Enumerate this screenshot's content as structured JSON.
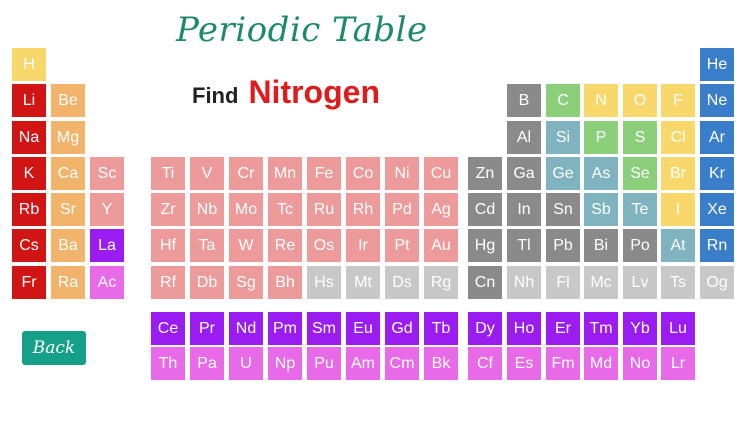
{
  "title": "Periodic Table",
  "prompt": {
    "find_label": "Find",
    "target": "Nitrogen"
  },
  "back_label": "Back",
  "colors": {
    "alkali": "#d11414",
    "alkaline": "#f2b36b",
    "hydrogen": "#f8d86b",
    "transition": "#ec9a9a",
    "unknown": "#c8c8c8",
    "post_transition": "#8e8e8e",
    "metalloid": "#7fb3bf",
    "nonmetal": "#8bcf7b",
    "halogen": "#f8d86b",
    "noble": "#3a7dc8",
    "lanthanide": "#9b1cf0",
    "actinide": "#e86ae8",
    "gray_dark": "#8a8a8a"
  },
  "rows": [
    {
      "row": 1,
      "elements": [
        {
          "symbol": "H",
          "col": 1,
          "type": "hydrogen"
        },
        {
          "symbol": "He",
          "col": 18,
          "type": "noble"
        }
      ]
    },
    {
      "row": 2,
      "elements": [
        {
          "symbol": "Li",
          "col": 1,
          "type": "alkali"
        },
        {
          "symbol": "Be",
          "col": 2,
          "type": "alkaline"
        },
        {
          "symbol": "B",
          "col": 13,
          "type": "gray_dark"
        },
        {
          "symbol": "C",
          "col": 14,
          "type": "nonmetal"
        },
        {
          "symbol": "N",
          "col": 15,
          "type": "halogen"
        },
        {
          "symbol": "O",
          "col": 16,
          "type": "halogen"
        },
        {
          "symbol": "F",
          "col": 17,
          "type": "halogen"
        },
        {
          "symbol": "Ne",
          "col": 18,
          "type": "noble"
        }
      ]
    },
    {
      "row": 3,
      "elements": [
        {
          "symbol": "Na",
          "col": 1,
          "type": "alkali"
        },
        {
          "symbol": "Mg",
          "col": 2,
          "type": "alkaline"
        },
        {
          "symbol": "Al",
          "col": 13,
          "type": "gray_dark"
        },
        {
          "symbol": "Si",
          "col": 14,
          "type": "metalloid"
        },
        {
          "symbol": "P",
          "col": 15,
          "type": "nonmetal"
        },
        {
          "symbol": "S",
          "col": 16,
          "type": "nonmetal"
        },
        {
          "symbol": "Cl",
          "col": 17,
          "type": "halogen"
        },
        {
          "symbol": "Ar",
          "col": 18,
          "type": "noble"
        }
      ]
    },
    {
      "row": 4,
      "elements": [
        {
          "symbol": "K",
          "col": 1,
          "type": "alkali"
        },
        {
          "symbol": "Ca",
          "col": 2,
          "type": "alkaline"
        },
        {
          "symbol": "Sc",
          "col": 3,
          "type": "transition"
        },
        {
          "symbol": "Ti",
          "col": 4,
          "type": "transition"
        },
        {
          "symbol": "V",
          "col": 5,
          "type": "transition"
        },
        {
          "symbol": "Cr",
          "col": 6,
          "type": "transition"
        },
        {
          "symbol": "Mn",
          "col": 7,
          "type": "transition"
        },
        {
          "symbol": "Fe",
          "col": 8,
          "type": "transition"
        },
        {
          "symbol": "Co",
          "col": 9,
          "type": "transition"
        },
        {
          "symbol": "Ni",
          "col": 10,
          "type": "transition"
        },
        {
          "symbol": "Cu",
          "col": 11,
          "type": "transition"
        },
        {
          "symbol": "Zn",
          "col": 12,
          "type": "gray_dark"
        },
        {
          "symbol": "Ga",
          "col": 13,
          "type": "gray_dark"
        },
        {
          "symbol": "Ge",
          "col": 14,
          "type": "metalloid"
        },
        {
          "symbol": "As",
          "col": 15,
          "type": "metalloid"
        },
        {
          "symbol": "Se",
          "col": 16,
          "type": "nonmetal"
        },
        {
          "symbol": "Br",
          "col": 17,
          "type": "halogen"
        },
        {
          "symbol": "Kr",
          "col": 18,
          "type": "noble"
        }
      ]
    },
    {
      "row": 5,
      "elements": [
        {
          "symbol": "Rb",
          "col": 1,
          "type": "alkali"
        },
        {
          "symbol": "Sr",
          "col": 2,
          "type": "alkaline"
        },
        {
          "symbol": "Y",
          "col": 3,
          "type": "transition"
        },
        {
          "symbol": "Zr",
          "col": 4,
          "type": "transition"
        },
        {
          "symbol": "Nb",
          "col": 5,
          "type": "transition"
        },
        {
          "symbol": "Mo",
          "col": 6,
          "type": "transition"
        },
        {
          "symbol": "Tc",
          "col": 7,
          "type": "transition"
        },
        {
          "symbol": "Ru",
          "col": 8,
          "type": "transition"
        },
        {
          "symbol": "Rh",
          "col": 9,
          "type": "transition"
        },
        {
          "symbol": "Pd",
          "col": 10,
          "type": "transition"
        },
        {
          "symbol": "Ag",
          "col": 11,
          "type": "transition"
        },
        {
          "symbol": "Cd",
          "col": 12,
          "type": "gray_dark"
        },
        {
          "symbol": "In",
          "col": 13,
          "type": "gray_dark"
        },
        {
          "symbol": "Sn",
          "col": 14,
          "type": "gray_dark"
        },
        {
          "symbol": "Sb",
          "col": 15,
          "type": "metalloid"
        },
        {
          "symbol": "Te",
          "col": 16,
          "type": "metalloid"
        },
        {
          "symbol": "I",
          "col": 17,
          "type": "halogen"
        },
        {
          "symbol": "Xe",
          "col": 18,
          "type": "noble"
        }
      ]
    },
    {
      "row": 6,
      "elements": [
        {
          "symbol": "Cs",
          "col": 1,
          "type": "alkali"
        },
        {
          "symbol": "Ba",
          "col": 2,
          "type": "alkaline"
        },
        {
          "symbol": "La",
          "col": 3,
          "type": "lanthanide"
        },
        {
          "symbol": "Hf",
          "col": 4,
          "type": "transition"
        },
        {
          "symbol": "Ta",
          "col": 5,
          "type": "transition"
        },
        {
          "symbol": "W",
          "col": 6,
          "type": "transition"
        },
        {
          "symbol": "Re",
          "col": 7,
          "type": "transition"
        },
        {
          "symbol": "Os",
          "col": 8,
          "type": "transition"
        },
        {
          "symbol": "Ir",
          "col": 9,
          "type": "transition"
        },
        {
          "symbol": "Pt",
          "col": 10,
          "type": "transition"
        },
        {
          "symbol": "Au",
          "col": 11,
          "type": "transition"
        },
        {
          "symbol": "Hg",
          "col": 12,
          "type": "gray_dark"
        },
        {
          "symbol": "Tl",
          "col": 13,
          "type": "gray_dark"
        },
        {
          "symbol": "Pb",
          "col": 14,
          "type": "gray_dark"
        },
        {
          "symbol": "Bi",
          "col": 15,
          "type": "gray_dark"
        },
        {
          "symbol": "Po",
          "col": 16,
          "type": "gray_dark"
        },
        {
          "symbol": "At",
          "col": 17,
          "type": "metalloid"
        },
        {
          "symbol": "Rn",
          "col": 18,
          "type": "noble"
        }
      ]
    },
    {
      "row": 7,
      "elements": [
        {
          "symbol": "Fr",
          "col": 1,
          "type": "alkali"
        },
        {
          "symbol": "Ra",
          "col": 2,
          "type": "alkaline"
        },
        {
          "symbol": "Ac",
          "col": 3,
          "type": "actinide"
        },
        {
          "symbol": "Rf",
          "col": 4,
          "type": "transition"
        },
        {
          "symbol": "Db",
          "col": 5,
          "type": "transition"
        },
        {
          "symbol": "Sg",
          "col": 6,
          "type": "transition"
        },
        {
          "symbol": "Bh",
          "col": 7,
          "type": "transition"
        },
        {
          "symbol": "Hs",
          "col": 8,
          "type": "unknown"
        },
        {
          "symbol": "Mt",
          "col": 9,
          "type": "unknown"
        },
        {
          "symbol": "Ds",
          "col": 10,
          "type": "unknown"
        },
        {
          "symbol": "Rg",
          "col": 11,
          "type": "unknown"
        },
        {
          "symbol": "Cn",
          "col": 12,
          "type": "gray_dark"
        },
        {
          "symbol": "Nh",
          "col": 13,
          "type": "unknown"
        },
        {
          "symbol": "Fl",
          "col": 14,
          "type": "unknown"
        },
        {
          "symbol": "Mc",
          "col": 15,
          "type": "unknown"
        },
        {
          "symbol": "Lv",
          "col": 16,
          "type": "unknown"
        },
        {
          "symbol": "Ts",
          "col": 17,
          "type": "unknown"
        },
        {
          "symbol": "Og",
          "col": 18,
          "type": "unknown"
        }
      ]
    },
    {
      "row": 9,
      "elements": [
        {
          "symbol": "Ce",
          "col": 4,
          "type": "lanthanide"
        },
        {
          "symbol": "Pr",
          "col": 5,
          "type": "lanthanide"
        },
        {
          "symbol": "Nd",
          "col": 6,
          "type": "lanthanide"
        },
        {
          "symbol": "Pm",
          "col": 7,
          "type": "lanthanide"
        },
        {
          "symbol": "Sm",
          "col": 8,
          "type": "lanthanide"
        },
        {
          "symbol": "Eu",
          "col": 9,
          "type": "lanthanide"
        },
        {
          "symbol": "Gd",
          "col": 10,
          "type": "lanthanide"
        },
        {
          "symbol": "Tb",
          "col": 11,
          "type": "lanthanide"
        },
        {
          "symbol": "Dy",
          "col": 12,
          "type": "lanthanide"
        },
        {
          "symbol": "Ho",
          "col": 13,
          "type": "lanthanide"
        },
        {
          "symbol": "Er",
          "col": 14,
          "type": "lanthanide"
        },
        {
          "symbol": "Tm",
          "col": 15,
          "type": "lanthanide"
        },
        {
          "symbol": "Yb",
          "col": 16,
          "type": "lanthanide"
        },
        {
          "symbol": "Lu",
          "col": 17,
          "type": "lanthanide"
        }
      ]
    },
    {
      "row": 10,
      "elements": [
        {
          "symbol": "Th",
          "col": 4,
          "type": "actinide"
        },
        {
          "symbol": "Pa",
          "col": 5,
          "type": "actinide"
        },
        {
          "symbol": "U",
          "col": 6,
          "type": "actinide"
        },
        {
          "symbol": "Np",
          "col": 7,
          "type": "actinide"
        },
        {
          "symbol": "Pu",
          "col": 8,
          "type": "actinide"
        },
        {
          "symbol": "Am",
          "col": 9,
          "type": "actinide"
        },
        {
          "symbol": "Cm",
          "col": 10,
          "type": "actinide"
        },
        {
          "symbol": "Bk",
          "col": 11,
          "type": "actinide"
        },
        {
          "symbol": "Cf",
          "col": 12,
          "type": "actinide"
        },
        {
          "symbol": "Es",
          "col": 13,
          "type": "actinide"
        },
        {
          "symbol": "Fm",
          "col": 14,
          "type": "actinide"
        },
        {
          "symbol": "Md",
          "col": 15,
          "type": "actinide"
        },
        {
          "symbol": "No",
          "col": 16,
          "type": "actinide"
        },
        {
          "symbol": "Lr",
          "col": 17,
          "type": "actinide"
        }
      ]
    }
  ]
}
